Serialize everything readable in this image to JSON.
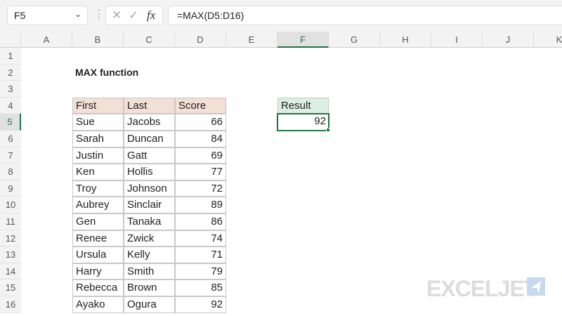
{
  "formula_bar": {
    "name_box": "F5",
    "formula": "=MAX(D5:D16)",
    "cancel_icon": "✕",
    "enter_icon": "✓",
    "fx_label": "fx"
  },
  "columns": [
    "A",
    "B",
    "C",
    "D",
    "E",
    "F",
    "G",
    "H",
    "I",
    "J",
    "K"
  ],
  "selected_column": "F",
  "selected_row": 5,
  "rows": [
    1,
    2,
    3,
    4,
    5,
    6,
    7,
    8,
    9,
    10,
    11,
    12,
    13,
    14,
    15,
    16
  ],
  "title": "MAX function",
  "table": {
    "headers": [
      "First",
      "Last",
      "Score"
    ],
    "rows": [
      [
        "Sue",
        "Jacobs",
        66
      ],
      [
        "Sarah",
        "Duncan",
        84
      ],
      [
        "Justin",
        "Gatt",
        69
      ],
      [
        "Ken",
        "Hollis",
        77
      ],
      [
        "Troy",
        "Johnson",
        72
      ],
      [
        "Aubrey",
        "Sinclair",
        89
      ],
      [
        "Gen",
        "Tanaka",
        86
      ],
      [
        "Renee",
        "Zwick",
        74
      ],
      [
        "Ursula",
        "Kelly",
        71
      ],
      [
        "Harry",
        "Smith",
        79
      ],
      [
        "Rebecca",
        "Brown",
        85
      ],
      [
        "Ayako",
        "Ogura",
        92
      ]
    ]
  },
  "result": {
    "label": "Result",
    "value": 92
  },
  "logo": "EXCELJET",
  "colors": {
    "accent": "#217346",
    "header_fill": "#f2dfd6",
    "result_fill": "#dcefe4"
  }
}
